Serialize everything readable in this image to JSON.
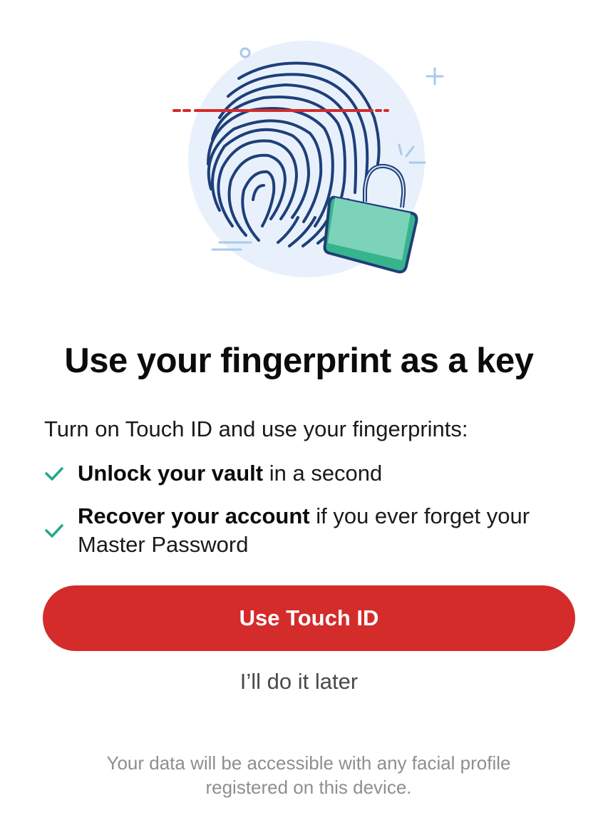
{
  "illustration": {
    "icon": "fingerprint-lock-illustration",
    "colors": {
      "circle": "#e8f1fb",
      "fingerprint": "#1e3f7a",
      "scan_line": "#d42b2b",
      "lock_body": "#7dd3b9",
      "lock_shade": "#36b48c",
      "sparkle": "#a9c9ec"
    }
  },
  "title": "Use your fingerprint as a key",
  "intro": "Turn on Touch ID and use your fingerprints:",
  "features": [
    {
      "bold": "Unlock your vault",
      "rest": " in a second",
      "icon": "check-icon"
    },
    {
      "bold": "Recover your account",
      "rest": " if you ever forget your Master Password",
      "icon": "check-icon"
    }
  ],
  "buttons": {
    "primary": "Use Touch ID",
    "secondary": "I’ll do it later"
  },
  "disclaimer": "Your data will be accessible with any facial profile registered on this device.",
  "colors": {
    "accent": "#d42b2b",
    "check": "#22a98a",
    "muted_text": "#8e8e93"
  }
}
